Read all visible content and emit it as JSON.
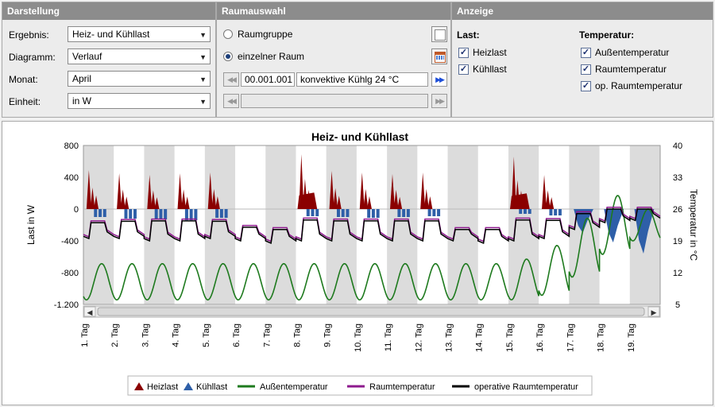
{
  "sections": {
    "darstellung": "Darstellung",
    "raumauswahl": "Raumauswahl",
    "anzeige": "Anzeige"
  },
  "darstellung": {
    "ergebnis_label": "Ergebnis:",
    "ergebnis_value": "Heiz- und Kühllast",
    "diagramm_label": "Diagramm:",
    "diagramm_value": "Verlauf",
    "monat_label": "Monat:",
    "monat_value": "April",
    "einheit_label": "Einheit:",
    "einheit_value": "in W"
  },
  "raumauswahl": {
    "radio_gruppe": "Raumgruppe",
    "radio_raum": "einzelner Raum",
    "selected": "einzelner Raum",
    "room_number": "00.001.001",
    "room_name": "konvektive Kühlg 24 °C"
  },
  "anzeige": {
    "last_title": "Last:",
    "heizlast": "Heizlast",
    "kuehllast": "Kühllast",
    "temp_title": "Temperatur:",
    "aussen": "Außentemperatur",
    "raum": "Raumtemperatur",
    "op_raum": "op. Raumtemperatur",
    "checked": [
      true,
      true,
      true,
      true,
      true
    ]
  },
  "chart_data": {
    "type": "line",
    "title": "Heiz- und Kühllast",
    "ylabel": "Last in W",
    "y2label": "Temperatur in °C",
    "ylim": [
      -1200,
      800
    ],
    "y2lim": [
      5,
      40
    ],
    "yticks": [
      "800",
      "400",
      "0",
      "-400",
      "-800",
      "-1.200"
    ],
    "y2ticks": [
      "40",
      "33",
      "26",
      "19",
      "12",
      "5"
    ],
    "days": [
      "1. Tag",
      "2. Tag",
      "3. Tag",
      "4. Tag",
      "5. Tag",
      "6. Tag",
      "7. Tag",
      "8. Tag",
      "9. Tag",
      "10. Tag",
      "11. Tag",
      "12. Tag",
      "13. Tag",
      "14. Tag",
      "15. Tag",
      "16. Tag",
      "17. Tag",
      "18. Tag",
      "19. Tag"
    ],
    "heizlast_daily_peak": [
      490,
      450,
      430,
      450,
      460,
      0,
      0,
      690,
      480,
      460,
      440,
      460,
      0,
      0,
      660,
      430,
      0,
      0,
      0
    ],
    "kuehllast_daily_min": [
      -100,
      -120,
      -130,
      -140,
      -110,
      0,
      0,
      -90,
      -100,
      -110,
      -100,
      -90,
      0,
      0,
      -60,
      -80,
      -300,
      -420,
      -560
    ],
    "aussen_daily_min": [
      6,
      6,
      6,
      6,
      6,
      6,
      6,
      6,
      6,
      6,
      6,
      6,
      6,
      6,
      6,
      7,
      11,
      16,
      19
    ],
    "aussen_daily_max": [
      14,
      14,
      14,
      14,
      14,
      14,
      14,
      14,
      14,
      14,
      14,
      14,
      14,
      14,
      15,
      18,
      24,
      29,
      26
    ],
    "raum_night": [
      20,
      20,
      19.5,
      19.5,
      20,
      19.5,
      19,
      19.5,
      19.5,
      19.5,
      19.5,
      19.5,
      19.5,
      19,
      19.5,
      20,
      22,
      23.5,
      24
    ],
    "raum_day": [
      23,
      23.3,
      23.4,
      23.4,
      23.3,
      22,
      21.5,
      23.6,
      23.4,
      23.4,
      23.4,
      23.4,
      21.5,
      21.5,
      23.6,
      23.5,
      25,
      26,
      26
    ],
    "legend": [
      "Heizlast",
      "Kühllast",
      "Außentemperatur",
      "Raumtemperatur",
      "operative Raumtemperatur"
    ],
    "colors": {
      "heizlast": "#8b0000",
      "kuehllast": "#2e5fa8",
      "aussen": "#1e7a1e",
      "raum": "#8e1a8e",
      "op_raum": "#000000",
      "weekend": "#dcdcdc"
    }
  }
}
